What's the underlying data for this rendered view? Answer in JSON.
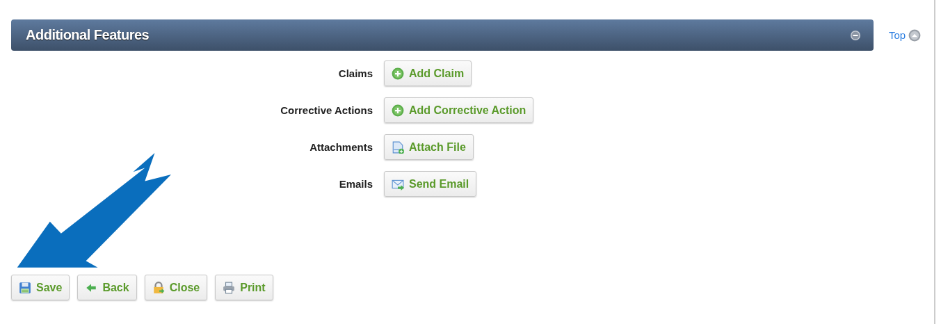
{
  "panel": {
    "title": "Additional Features",
    "expanded": true
  },
  "top_link": "Top",
  "features": [
    {
      "label": "Claims",
      "button": {
        "kind": "add",
        "label": "Add Claim"
      }
    },
    {
      "label": "Corrective Actions",
      "button": {
        "kind": "add",
        "label": "Add Corrective Action"
      }
    },
    {
      "label": "Attachments",
      "button": {
        "kind": "attach",
        "label": "Attach File"
      }
    },
    {
      "label": "Emails",
      "button": {
        "kind": "email",
        "label": "Send Email"
      }
    }
  ],
  "actions": [
    {
      "kind": "save",
      "label": "Save"
    },
    {
      "kind": "back",
      "label": "Back"
    },
    {
      "kind": "close",
      "label": "Close"
    },
    {
      "kind": "print",
      "label": "Print"
    }
  ]
}
